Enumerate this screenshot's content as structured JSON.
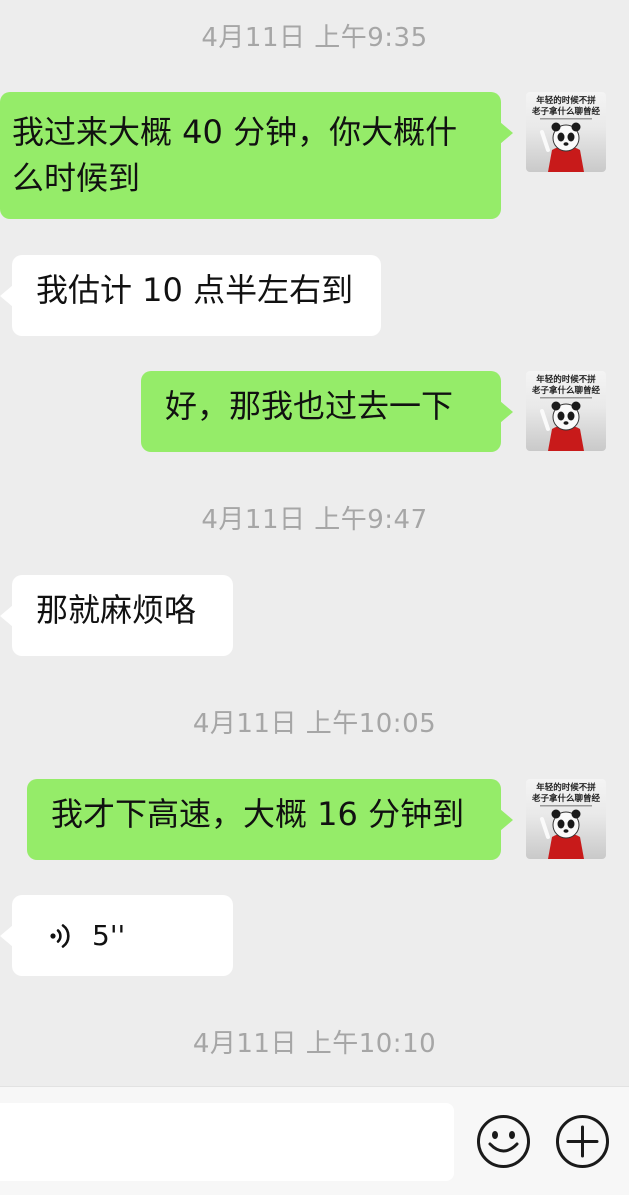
{
  "timestamps": [
    "4月11日 上午9:35",
    "4月11日 上午9:47",
    "4月11日 上午10:05",
    "4月11日 上午10:10"
  ],
  "messages": [
    {
      "side": "out",
      "text_line1": "我过来大概 40 分钟，你大概什",
      "text_line2": "么时候到"
    },
    {
      "side": "in",
      "text": "我估计 10 点半左右到"
    },
    {
      "side": "out",
      "text": "好，那我也过去一下"
    },
    {
      "side": "in",
      "text": "那就麻烦咯"
    },
    {
      "side": "out",
      "text": "我才下高速，大概 16 分钟到"
    },
    {
      "side": "in",
      "type": "voice",
      "duration": "5''"
    }
  ],
  "avatar": {
    "line1": "年轻的时候不拼",
    "line2": "老子拿什么聊曾经",
    "icon": "panda-avatar-icon"
  },
  "input": {
    "value": "",
    "emoji_icon": "emoji-icon",
    "plus_icon": "plus-icon"
  },
  "colors": {
    "background": "#ededed",
    "outgoing_bubble": "#95ec69",
    "incoming_bubble": "#ffffff",
    "timestamp_text": "#a6a6a6"
  }
}
